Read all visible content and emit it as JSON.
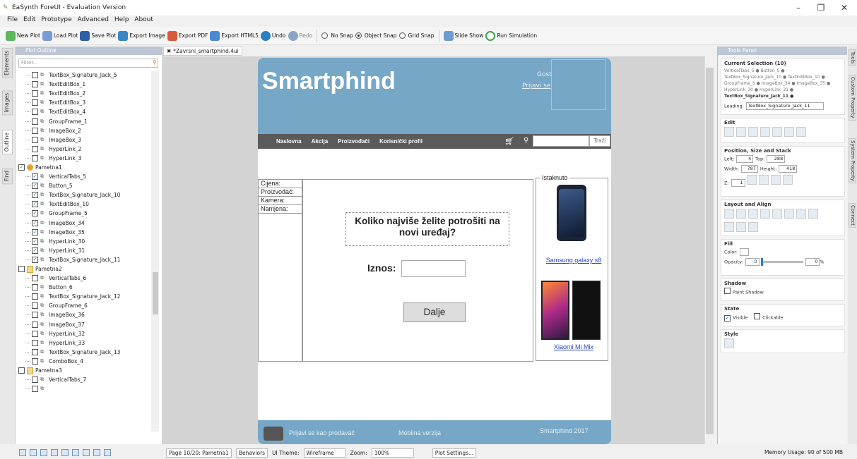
{
  "window": {
    "title": "EaSynth ForeUI - Evaluation Version",
    "minimize": "–",
    "maximize": "❐",
    "close": "✕"
  },
  "menu": [
    "File",
    "Edit",
    "Prototype",
    "Advanced",
    "Help",
    "About"
  ],
  "toolbar": {
    "new_plot": "New Plot",
    "load_plot": "Load Plot",
    "save_plot": "Save Plot",
    "export_image": "Export Image",
    "export_pdf": "Export PDF",
    "export_html5": "Export HTML5",
    "undo": "Undo",
    "redo": "Redo",
    "no_snap": "No Snap",
    "object_snap": "Object Snap",
    "grid_snap": "Grid Snap",
    "slide_show": "Slide Show",
    "run_simulation": "Run Simulation"
  },
  "left_tabs": [
    "Elements",
    "Images",
    "Outline",
    "Find"
  ],
  "plot_outline": {
    "title": "Plot Outline",
    "filter_placeholder": "Filter...",
    "rows": [
      {
        "label": "TextBox_Signature_Jack_5",
        "checked": false,
        "kind": "item",
        "indent": 1
      },
      {
        "label": "TextEditBox_1",
        "checked": false,
        "kind": "item",
        "indent": 1
      },
      {
        "label": "TextEditBox_2",
        "checked": false,
        "kind": "item",
        "indent": 1
      },
      {
        "label": "TextEditBox_3",
        "checked": false,
        "kind": "item",
        "indent": 1
      },
      {
        "label": "TextEditBox_4",
        "checked": false,
        "kind": "item",
        "indent": 1
      },
      {
        "label": "GroupFrame_1",
        "checked": false,
        "kind": "item",
        "indent": 1
      },
      {
        "label": "ImageBox_2",
        "checked": false,
        "kind": "item",
        "indent": 1
      },
      {
        "label": "ImageBox_3",
        "checked": false,
        "kind": "item",
        "indent": 1
      },
      {
        "label": "HyperLink_2",
        "checked": false,
        "kind": "item",
        "indent": 1
      },
      {
        "label": "HyperLink_3",
        "checked": false,
        "kind": "item",
        "indent": 1
      },
      {
        "label": "Pametna1",
        "checked": true,
        "kind": "page-active",
        "indent": 0
      },
      {
        "label": "VerticalTabs_5",
        "checked": true,
        "kind": "item",
        "indent": 1
      },
      {
        "label": "Button_5",
        "checked": true,
        "kind": "item",
        "indent": 1
      },
      {
        "label": "TextBox_Signature_Jack_10",
        "checked": true,
        "kind": "item",
        "indent": 1
      },
      {
        "label": "TextEditBox_10",
        "checked": true,
        "kind": "item",
        "indent": 1
      },
      {
        "label": "GroupFrame_5",
        "checked": true,
        "kind": "item",
        "indent": 1
      },
      {
        "label": "ImageBox_34",
        "checked": true,
        "kind": "item",
        "indent": 1
      },
      {
        "label": "ImageBox_35",
        "checked": true,
        "kind": "item",
        "indent": 1
      },
      {
        "label": "HyperLink_30",
        "checked": true,
        "kind": "item",
        "indent": 1
      },
      {
        "label": "HyperLink_31",
        "checked": true,
        "kind": "item",
        "indent": 1
      },
      {
        "label": "TextBox_Signature_Jack_11",
        "checked": true,
        "kind": "item",
        "indent": 1
      },
      {
        "label": "Pametna2",
        "checked": false,
        "kind": "page",
        "indent": 0
      },
      {
        "label": "VerticalTabs_6",
        "checked": false,
        "kind": "item",
        "indent": 1
      },
      {
        "label": "Button_6",
        "checked": false,
        "kind": "item",
        "indent": 1
      },
      {
        "label": "TextBox_Signature_Jack_12",
        "checked": false,
        "kind": "item",
        "indent": 1
      },
      {
        "label": "GroupFrame_6",
        "checked": false,
        "kind": "item",
        "indent": 1
      },
      {
        "label": "ImageBox_36",
        "checked": false,
        "kind": "item",
        "indent": 1
      },
      {
        "label": "ImageBox_37",
        "checked": false,
        "kind": "item",
        "indent": 1
      },
      {
        "label": "HyperLink_32",
        "checked": false,
        "kind": "item",
        "indent": 1
      },
      {
        "label": "HyperLink_33",
        "checked": false,
        "kind": "item",
        "indent": 1
      },
      {
        "label": "TextBox_Signature_Jack_13",
        "checked": false,
        "kind": "item",
        "indent": 1
      },
      {
        "label": "ComboBox_4",
        "checked": false,
        "kind": "item",
        "indent": 1
      },
      {
        "label": "Pametna3",
        "checked": false,
        "kind": "page",
        "indent": 0
      },
      {
        "label": "VerticalTabs_7",
        "checked": false,
        "kind": "item",
        "indent": 1
      },
      {
        "label": "",
        "checked": false,
        "kind": "item",
        "indent": 1
      }
    ]
  },
  "editor": {
    "tab": "*Zavrsni_smartphind.4ui"
  },
  "page": {
    "brand": "Smartphind",
    "gost": "Gost",
    "prijavi": "Prijavi se",
    "nav": [
      "Naslovna",
      "Akcija",
      "Proizvođači",
      "Korisnički profil"
    ],
    "search_button": "Traži",
    "filters": [
      "Cijena:",
      "Proizvođač:",
      "Kamera:",
      "Namjena:"
    ],
    "question": "Koliko najviše želite potrošiti na novi uređaj?",
    "amount_label": "Iznos:",
    "next_button": "Dalje",
    "featured_legend": "Istaknuto",
    "phone1": "Samsung galaxy s8",
    "phone2": "Xiaomi Mi Mix",
    "footer_seller": "Prijavi se kao prodavač",
    "footer_mobile": "Mobilna verzija",
    "footer_copy": "Smartphind 2017"
  },
  "status": {
    "page": "Page 10/20: Pametna1",
    "behaviors": "Behaviors",
    "ui_theme_label": "UI Theme:",
    "ui_theme": "Wireframe",
    "zoom_label": "Zoom:",
    "zoom": "100%",
    "plot_settings": "Plot Settings...",
    "memory": "Memory Usage: 90 of 500 MB"
  },
  "tools": {
    "title": "Tools Panel",
    "current_selection": "Current Selection (10)",
    "selection_text": "VerticalTabs_5 ● Button_5 ● TextBox_Signature_Jack_10 ● TextEditBox_10 ● GroupFrame_5 ● ImageBox_34 ● ImageBox_35 ● HyperLink_30 ● HyperLink_31 ●",
    "selection_bold": "TextBox_Signature_Jack_11 ●",
    "leading_label": "Leading:",
    "leading_value": "TextBox_Signature_Jack_11",
    "edit": "Edit",
    "position": "Position, Size and Stack",
    "left_label": "Left:",
    "left": "4",
    "top_label": "Top:",
    "top": "288",
    "width_label": "Width:",
    "width": "787",
    "height_label": "Height:",
    "height": "418",
    "z_label": "Z:",
    "z": "1",
    "layout": "Layout and Align",
    "fill": "Fill",
    "color_label": "Color:",
    "opacity_label": "Opacity:",
    "opacity": "0",
    "opacity2": "0",
    "pct": "%",
    "shadow": "Shadow",
    "paint_shadow": "Paint Shadow",
    "state": "State",
    "visible": "Visible",
    "clickable": "Clickable",
    "style": "Style"
  },
  "right_tabs": [
    "Tools",
    "Custom Property",
    "System Property",
    "Connect"
  ],
  "colors": {
    "header": "#76a7c7",
    "nav": "#5a5a5a",
    "link": "#2545c8"
  }
}
